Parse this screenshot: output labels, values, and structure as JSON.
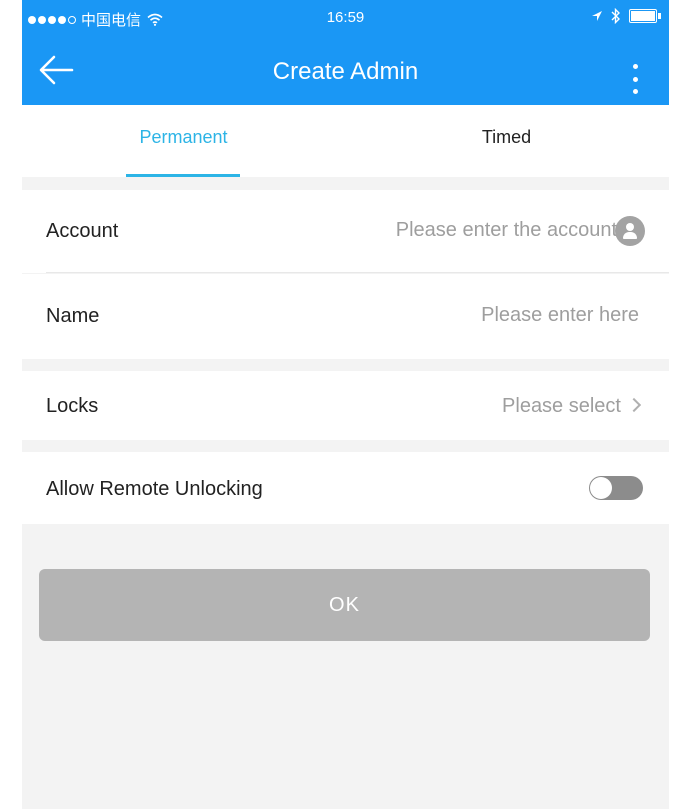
{
  "status_bar": {
    "carrier": "中国电信",
    "time": "16:59",
    "wifi_icon": "wifi-icon",
    "location_icon": "location-arrow-icon",
    "bluetooth_icon": "bluetooth-icon",
    "battery_icon": "battery-icon"
  },
  "navbar": {
    "title": "Create Admin",
    "back_icon": "arrow-left-icon",
    "more_icon": "more-vertical-icon"
  },
  "tabs": {
    "items": [
      {
        "label": "Permanent",
        "active": true
      },
      {
        "label": "Timed",
        "active": false
      }
    ]
  },
  "form": {
    "account": {
      "label": "Account",
      "placeholder": "Please enter the account",
      "value": ""
    },
    "name": {
      "label": "Name",
      "placeholder": "Please enter here",
      "value": ""
    },
    "locks": {
      "label": "Locks",
      "value": "Please select"
    },
    "remote_unlocking": {
      "label": "Allow Remote Unlocking",
      "enabled": false
    }
  },
  "ok_button": {
    "label": "OK"
  },
  "colors": {
    "primary": "#1a97f5",
    "tab_active": "#2cb4e6",
    "button_disabled": "#b4b4b4",
    "background": "#f3f3f3"
  }
}
